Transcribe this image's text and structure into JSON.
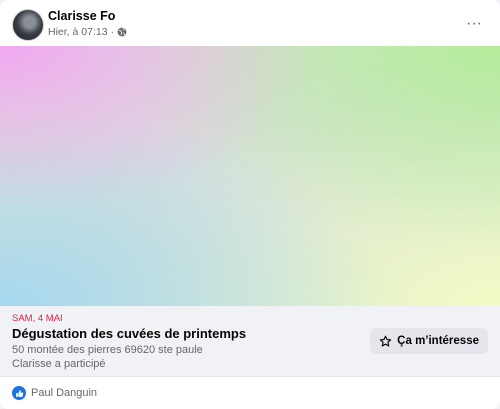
{
  "post": {
    "author": "Clarisse Fo",
    "timestamp": "Hier, à 07:13 ·",
    "audience_icon": "globe-icon",
    "menu_icon": "more-options-icon",
    "menu_label": "···"
  },
  "event": {
    "date": "SAM, 4 MAI",
    "title": "Dégustation des cuvées de printemps",
    "address": "50 montée des pierres 69620 ste paule",
    "participation": "Clarisse a participé",
    "interest_button": "Ça m’intéresse",
    "interest_icon": "star-icon"
  },
  "reactions": {
    "icon": "like-icon",
    "names": "Paul Danguin"
  },
  "colors": {
    "date_red": "#e41e3f",
    "like_blue": "#1b74e4",
    "details_bg": "#f0f2f5"
  }
}
